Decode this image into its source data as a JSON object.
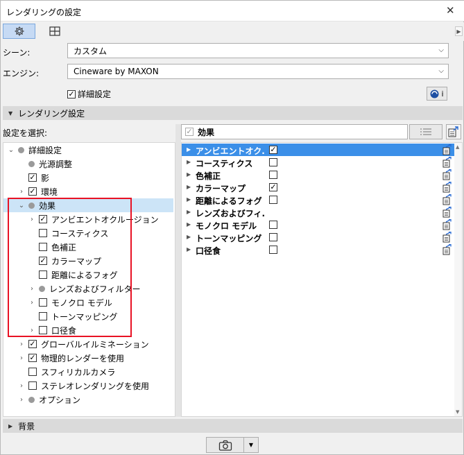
{
  "window": {
    "title": "レンダリングの設定",
    "close_label": "✕"
  },
  "tabs": [
    {
      "icon": "gear-icon"
    },
    {
      "icon": "layout-icon"
    }
  ],
  "scene": {
    "label": "シーン:",
    "value": "カスタム"
  },
  "engine": {
    "label": "エンジン:",
    "value": "Cineware by MAXON"
  },
  "advanced": {
    "label": "詳細設定",
    "checked": true
  },
  "info_button": {
    "label": "i",
    "icon": "cinema4d-logo-icon"
  },
  "rendering_settings": {
    "label": "レンダリング設定"
  },
  "select_settings": {
    "label": "設定を選択:"
  },
  "filter": {
    "label": "効果",
    "checked": true
  },
  "tree": [
    {
      "label": "詳細設定",
      "expand": "open",
      "type": "dot"
    },
    {
      "label": "光源調整",
      "expand": "",
      "type": "dot"
    },
    {
      "label": "影",
      "expand": "",
      "type": "cb",
      "checked": true
    },
    {
      "label": "環境",
      "expand": "closed",
      "type": "cb",
      "checked": true
    },
    {
      "label": "効果",
      "expand": "open",
      "type": "dot",
      "selected": true
    },
    {
      "label": "アンビエントオクルージョン",
      "expand": "closed",
      "type": "cb",
      "checked": true
    },
    {
      "label": "コースティクス",
      "expand": "",
      "type": "cb",
      "checked": false
    },
    {
      "label": "色補正",
      "expand": "",
      "type": "cb",
      "checked": false
    },
    {
      "label": "カラーマップ",
      "expand": "",
      "type": "cb",
      "checked": true
    },
    {
      "label": "距離によるフォグ",
      "expand": "",
      "type": "cb",
      "checked": false
    },
    {
      "label": "レンズおよびフィルター",
      "expand": "closed",
      "type": "dot"
    },
    {
      "label": "モノクロ モデル",
      "expand": "closed",
      "type": "cb",
      "checked": false
    },
    {
      "label": "トーンマッピング",
      "expand": "",
      "type": "cb",
      "checked": false
    },
    {
      "label": "口径食",
      "expand": "closed",
      "type": "cb",
      "checked": false
    },
    {
      "label": "グローバルイルミネーション",
      "expand": "closed",
      "type": "cb",
      "checked": true
    },
    {
      "label": "物理的レンダーを使用",
      "expand": "closed",
      "type": "cb",
      "checked": true
    },
    {
      "label": "スフィリカルカメラ",
      "expand": "",
      "type": "cb",
      "checked": false
    },
    {
      "label": "ステレオレンダリングを使用",
      "expand": "closed",
      "type": "cb",
      "checked": false
    },
    {
      "label": "オプション",
      "expand": "closed",
      "type": "dot"
    }
  ],
  "effects_list": [
    {
      "label": "アンビエントオク...",
      "checked": true,
      "has_cb": true,
      "selected": true
    },
    {
      "label": "コースティクス",
      "checked": false,
      "has_cb": true
    },
    {
      "label": "色補正",
      "checked": false,
      "has_cb": true
    },
    {
      "label": "カラーマップ",
      "checked": true,
      "has_cb": true
    },
    {
      "label": "距離によるフォグ",
      "checked": false,
      "has_cb": true
    },
    {
      "label": "レンズおよびフィ...",
      "checked": false,
      "has_cb": false
    },
    {
      "label": "モノクロ モデル",
      "checked": false,
      "has_cb": true
    },
    {
      "label": "トーンマッピング",
      "checked": false,
      "has_cb": true
    },
    {
      "label": "口径食",
      "checked": false,
      "has_cb": true
    }
  ],
  "background": {
    "label": "背景"
  },
  "capture": {
    "icon": "camera-icon"
  },
  "colors": {
    "selection": "#3b8fe8",
    "highlight_box": "#e81123",
    "tab_active": "#c6daf4"
  }
}
